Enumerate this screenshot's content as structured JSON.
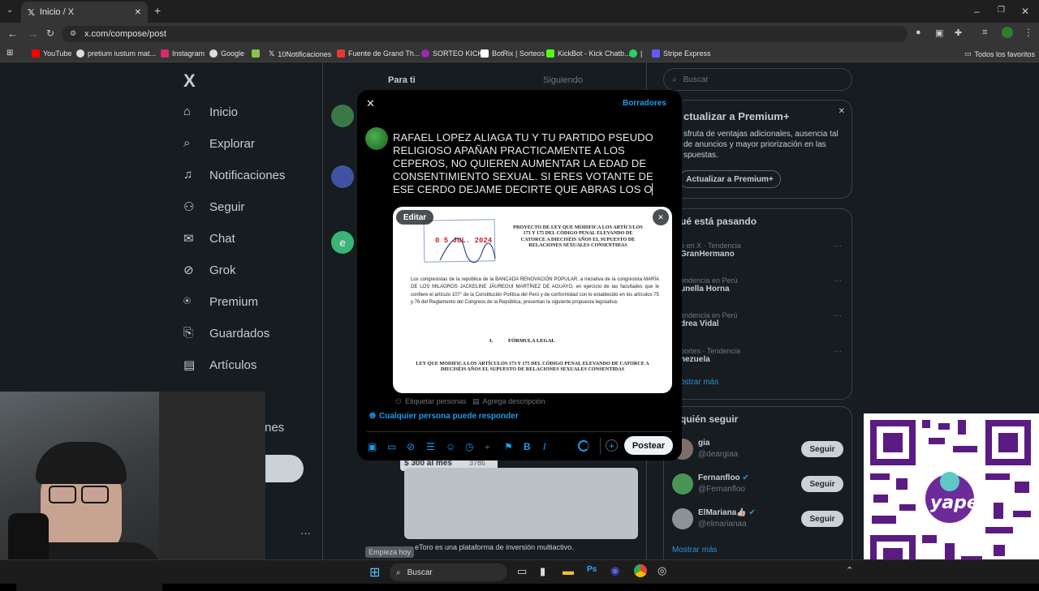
{
  "browser": {
    "tab_title": "Inicio / X",
    "url": "x.com/compose/post",
    "bookmarks": [
      "YouTube",
      "pretium iustum mat...",
      "Instagram",
      "Google",
      "10Notificaciones",
      "Fuente de Grand Th...",
      "SORTEO KICK",
      "BotRix | Sorteos",
      "KickBot - Kick Chatb...",
      "|",
      "Stripe Express"
    ],
    "all_bookmarks": "Todos los favoritos"
  },
  "nav": {
    "logo": "X",
    "items": [
      "Inicio",
      "Explorar",
      "Notificaciones",
      "Seguir",
      "Chat",
      "Grok",
      "Premium",
      "Guardados",
      "Artículos"
    ],
    "partial_more": "nes"
  },
  "feed": {
    "tabs": [
      "Para ti",
      "Siguiendo"
    ]
  },
  "search": {
    "placeholder": "Buscar"
  },
  "premium_card": {
    "title": "ctualizar a Premium+",
    "body": "sfruta de ventajas adicionales, ausencia tal de anuncios y mayor priorización en las spuestas.",
    "button": "Actualizar a Premium+"
  },
  "trends": {
    "title": "ué está pasando",
    "items": [
      {
        "meta": "o en X · Tendencia",
        "name": "GranHermano"
      },
      {
        "meta": "endencia en Perú",
        "name": "unella Horna"
      },
      {
        "meta": "endencia en Perú",
        "name": "drea Vidal"
      },
      {
        "meta": "portes · Tendencia",
        "name": "nezuela"
      }
    ],
    "show_more": "ostrar más"
  },
  "who_to_follow": {
    "title": "quién seguir",
    "users": [
      {
        "name": "gia",
        "handle": "@deargiaa",
        "button": "Seguir"
      },
      {
        "name": "Fernanfloo",
        "handle": "@Fernanfloo",
        "button": "Seguir"
      },
      {
        "name": "ElMariana👍🏻",
        "handle": "@elmarianaa",
        "button": "Seguir"
      }
    ],
    "show_more": "Mostrar más"
  },
  "compose": {
    "drafts": "Borradores",
    "text": "RAFAEL LOPEZ ALIAGA TU Y TU PARTIDO PSEUDO RELIGIOSO APAÑAN PRACTICAMENTE A LOS CEPEROS, NO QUIEREN AUMENTAR LA EDAD DE CONSENTIMIENTO SEXUAL. SI ERES VOTANTE DE ESE CERDO DEJAME DECIRTE QUE ABRAS LOS O",
    "edit_label": "Editar",
    "tag_people": "Etiquetar personas",
    "add_description": "Agrega descripción",
    "reply_setting": "Cualquier persona puede responder",
    "post_button": "Postear"
  },
  "document": {
    "stamp_date": "0 5 JUL. 2024",
    "heading": "PROYECTO DE LEY QUE MODIFICA LOS ARTÍCULOS 173 Y 175 DEL CÓDIGO PENAL ELEVANDO DE CATORCE A DIECISÉIS AÑOS EL SUPUESTO DE RELACIONES SEXUALES CONSENTIDAS",
    "body": "Los congresistas de la república de la BANCADA RENOVACIÓN POPULAR, a iniciativa de la congresista MARÍA DE LOS MILAGROS JACKELINE JÁUREGUI MARTÍNEZ DE AGUAYO, en ejercicio de las facultades que le confiere el artículo 107° de la Constitución Política del Perú y de conformidad con lo establecido en los artículos 75 y 76 del Reglamento del Congreso de la República, presentan la siguiente propuesta legislativa:",
    "section_num": "I.",
    "section_title": "FÓRMULA LEGAL",
    "law_title": "LEY QUE MODIFICA LOS ARTÍCULOS 173 Y 175 DEL CÓDIGO PENAL ELEVANDO DE CATORCE A DIECISÉIS AÑOS EL SUPUESTO DE RELACIONES SEXUALES CONSENTIDAS"
  },
  "ad": {
    "price": "$ 300 al mes",
    "count": "3786",
    "text": "eToro es una plataforma de inversión multiactivo.",
    "cta": "Empieza hoy"
  },
  "taskbar": {
    "search_label": "Buscar"
  },
  "qr": {
    "brand": "yape"
  }
}
